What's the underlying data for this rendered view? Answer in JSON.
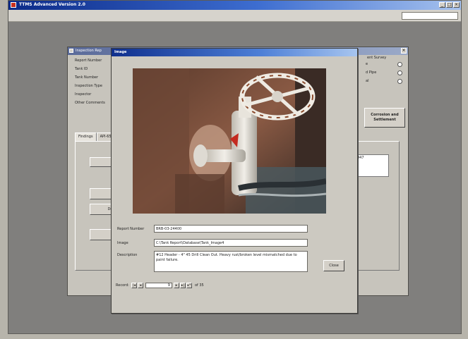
{
  "app": {
    "title": "TTMS Advanced Version 2.0",
    "window_controls": [
      "_",
      "□",
      "×"
    ]
  },
  "form": {
    "title": "Inspection Rep",
    "fields": [
      {
        "label": "Report Number"
      },
      {
        "label": "Tank ID"
      },
      {
        "label": "Tank Number"
      },
      {
        "label": "Inspection Type"
      },
      {
        "label": "Inspector"
      },
      {
        "label": "Other Comments"
      }
    ],
    "tabs": [
      "Findings",
      "API-65"
    ],
    "left_buttons": [
      "C",
      "Delete",
      "E"
    ],
    "survey": {
      "title": "ent Survey",
      "options": [
        "e",
        "d Pipe",
        "al"
      ]
    },
    "action_button": "Corrosion and Settlement",
    "list_value": "947"
  },
  "image_dialog": {
    "title": "Image",
    "labels": {
      "report_number": "Report Number",
      "image": "Image",
      "description": "Description"
    },
    "values": {
      "report_number": "BRB-03-24400",
      "image": "C:\\Tank Report\\Database\\Tank_Image4",
      "description": "#12 Header - 4\" 45 Drill Clean Out. Heavy rust/broken level mismatched due to paint failure."
    },
    "close_label": "Close",
    "record_nav": {
      "label": "Record:",
      "current": "9",
      "of_label": "of 35"
    },
    "photo": {
      "subject": "white-valve-handwheel-photo",
      "colors": {
        "pipe": "#e9e6df",
        "rust": "#8a4a2c",
        "background": "#3a2a22"
      }
    }
  }
}
